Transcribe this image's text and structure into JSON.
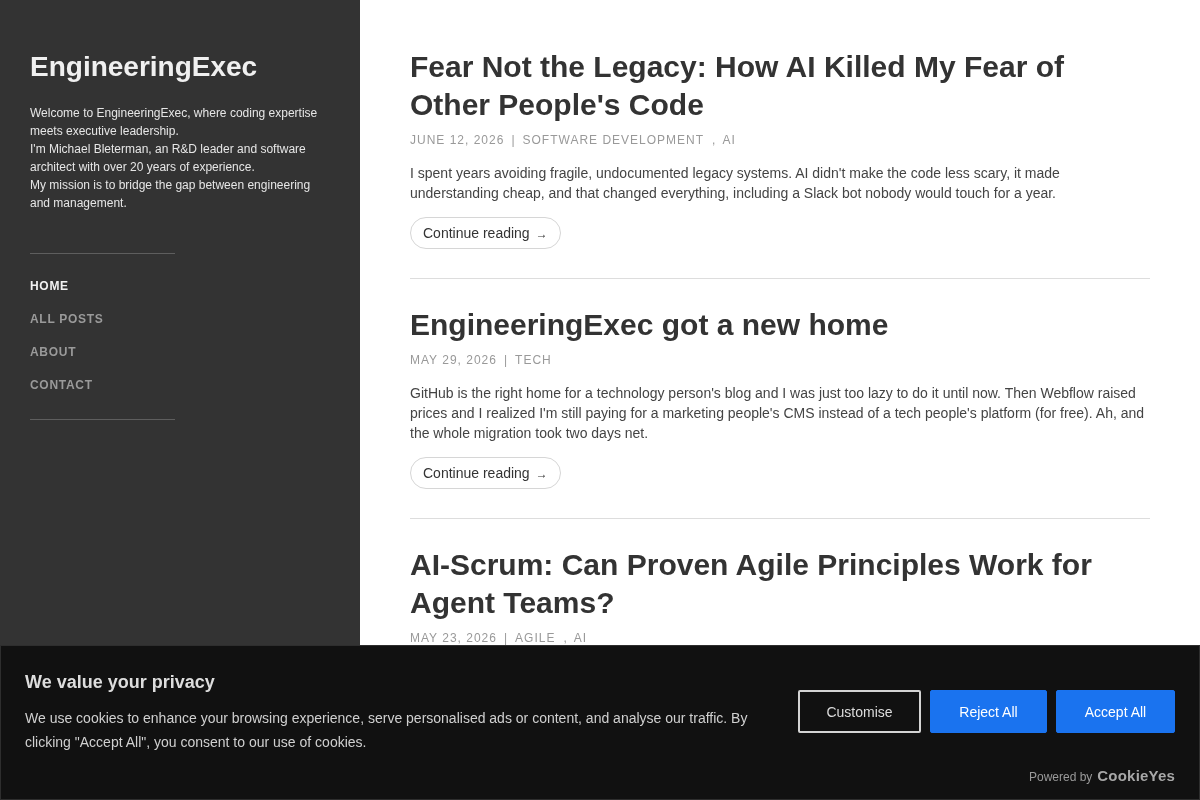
{
  "sidebar": {
    "title": "EngineeringExec",
    "intro": [
      "Welcome to EngineeringExec, where coding expertise meets executive leadership.",
      "I'm Michael Bleterman, an R&D leader and software architect with over 20 years of experience.",
      "My mission is to bridge the gap between engineering and management."
    ],
    "nav": [
      {
        "label": "HOME",
        "selected": true
      },
      {
        "label": "ALL POSTS",
        "selected": false
      },
      {
        "label": "ABOUT",
        "selected": false
      },
      {
        "label": "CONTACT",
        "selected": false
      }
    ]
  },
  "posts": [
    {
      "title": "Fear Not the Legacy: How AI Killed My Fear of Other People's Code",
      "date": "JUNE 12, 2026",
      "separator": "|",
      "categories": [
        "SOFTWARE DEVELOPMENT",
        "AI"
      ],
      "category_separator": ",",
      "excerpt": "I spent years avoiding fragile, undocumented legacy systems. AI didn't make the code less scary, it made understanding cheap, and that changed everything, including a Slack bot nobody would touch for a year.",
      "link": {
        "label": "Continue reading",
        "arrow": "→"
      }
    },
    {
      "title": "EngineeringExec got a new home",
      "date": "MAY 29, 2026",
      "separator": "|",
      "categories": [
        "TECH"
      ],
      "excerpt": "GitHub is the right home for a technology person's blog and I was just too lazy to do it until now. Then Webflow raised prices and I realized I'm still paying for a marketing people's CMS instead of a tech people's platform (for free). Ah, and the whole migration took two days net.",
      "link": {
        "label": "Continue reading",
        "arrow": "→"
      }
    },
    {
      "title": "AI-Scrum: Can Proven Agile Principles Work for Agent Teams?",
      "date": "MAY 23, 2026",
      "separator": "|",
      "categories": [
        "AGILE",
        "AI"
      ],
      "category_separator": ","
    }
  ],
  "cookie_banner": {
    "title": "We value your privacy",
    "message": "We use cookies to enhance your browsing experience, serve personalised ads or content, and analyse our traffic. By clicking \"Accept All\", you consent to our use of cookies.",
    "buttons": [
      {
        "label": "Customise",
        "kind": "outline"
      },
      {
        "label": "Reject All",
        "kind": "primary"
      },
      {
        "label": "Accept All",
        "kind": "primary"
      }
    ],
    "powered_by": "Powered by",
    "brand": "CookieYes"
  }
}
